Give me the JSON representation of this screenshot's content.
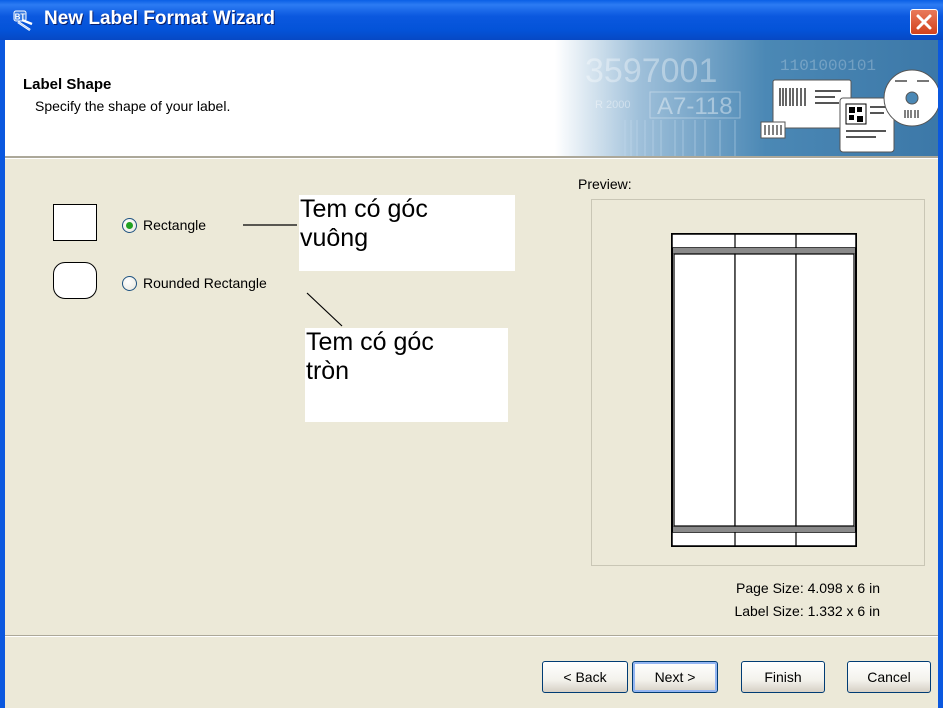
{
  "window": {
    "title": "New Label Format Wizard"
  },
  "header": {
    "title": "Label Shape",
    "subtitle": "Specify the shape of your label.",
    "banner_text": [
      "3597001",
      "A7-118",
      "1101000101",
      "R 2000"
    ]
  },
  "shapes": {
    "options": [
      {
        "label": "Rectangle",
        "selected": true
      },
      {
        "label": "Rounded Rectangle",
        "selected": false
      }
    ]
  },
  "annotations": {
    "square_note": [
      "Tem có góc",
      "vuông"
    ],
    "round_note": [
      "Tem có góc",
      "tròn"
    ]
  },
  "preview": {
    "caption": "Preview:",
    "page_size": "Page Size:  4.098 x 6 in",
    "label_size": "Label Size:  1.332 x 6 in"
  },
  "buttons": {
    "back": "< Back",
    "next": "Next >",
    "finish": "Finish",
    "cancel": "Cancel"
  },
  "colors": {
    "titlebar": "#0b58df",
    "dialog_bg": "#ece9d8",
    "radio_selected": "#21a121",
    "close_button": "#d2421c",
    "banner_bg": "#4b88b5"
  }
}
